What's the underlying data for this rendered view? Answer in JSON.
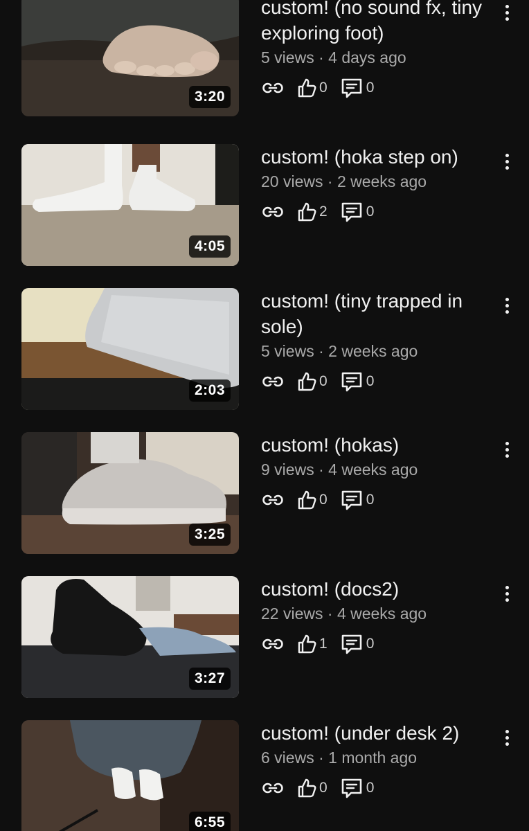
{
  "videos": [
    {
      "title": "custom! (no sound fx, tiny exploring foot)",
      "views": "5 views",
      "sep": "·",
      "age": "4 days ago",
      "likes": "0",
      "comments": "0",
      "duration": "3:20",
      "thumb_icon": "bare-foot-on-carpet"
    },
    {
      "title": "custom! (hoka step on)",
      "views": "20 views",
      "sep": "·",
      "age": "2 weeks ago",
      "likes": "2",
      "comments": "0",
      "duration": "4:05",
      "thumb_icon": "white-socks-on-floor"
    },
    {
      "title": "custom! (tiny trapped in sole)",
      "views": "5 views",
      "sep": "·",
      "age": "2 weeks ago",
      "likes": "0",
      "comments": "0",
      "duration": "2:03",
      "thumb_icon": "sock-sole-closeup"
    },
    {
      "title": "custom! (hokas)",
      "views": "9 views",
      "sep": "·",
      "age": "4 weeks ago",
      "likes": "0",
      "comments": "0",
      "duration": "3:25",
      "thumb_icon": "sneaker-side"
    },
    {
      "title": "custom! (docs2)",
      "views": "22 views",
      "sep": "·",
      "age": "4 weeks ago",
      "likes": "1",
      "comments": "0",
      "duration": "3:27",
      "thumb_icon": "black-boot-on-bed"
    },
    {
      "title": "custom! (under desk 2)",
      "views": "6 views",
      "sep": "·",
      "age": "1 month ago",
      "likes": "0",
      "comments": "0",
      "duration": "6:55",
      "thumb_icon": "feet-under-desk"
    }
  ],
  "colors": {
    "background": "#0f0f0f",
    "title": "#f1f1f1",
    "meta": "#aaaaaa",
    "icon": "#f1f1f1"
  }
}
